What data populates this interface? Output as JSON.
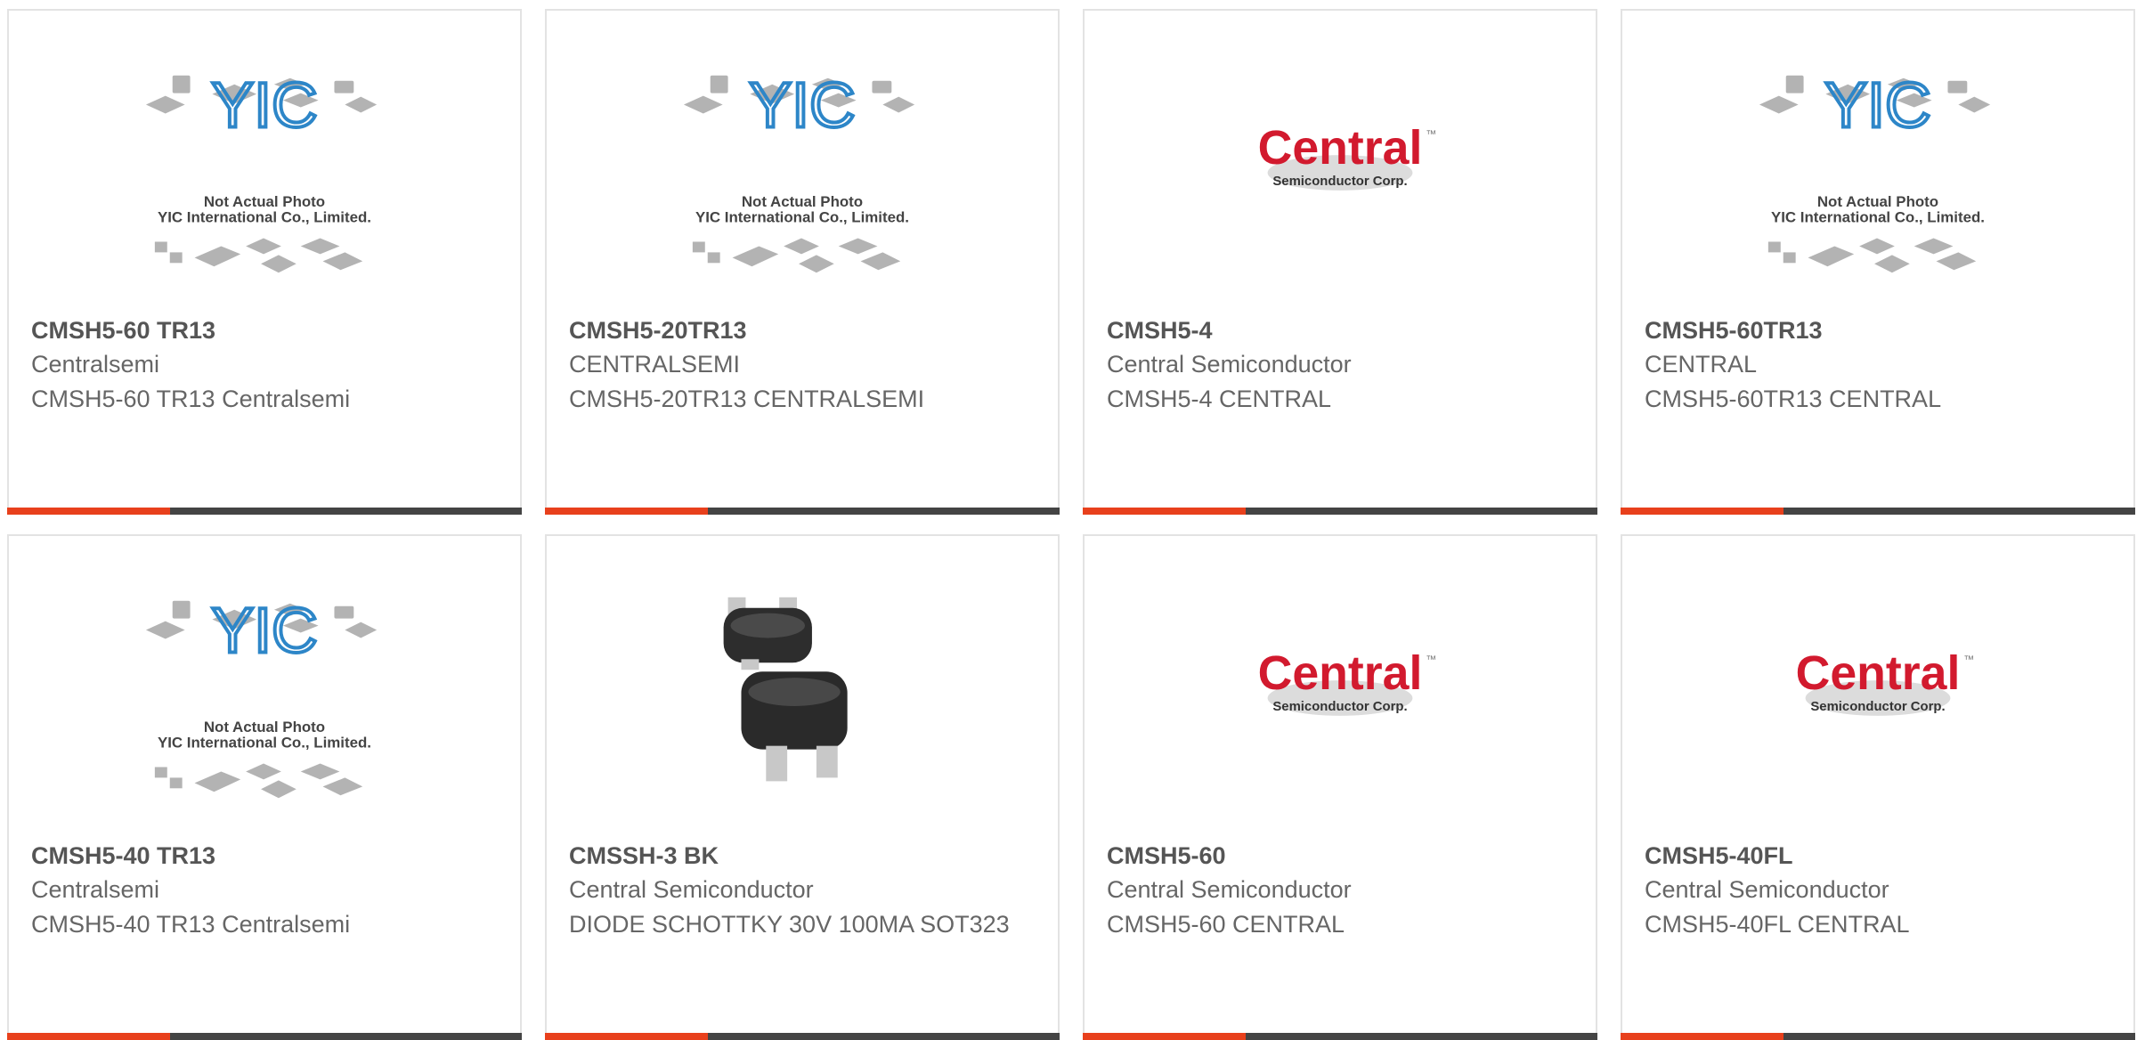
{
  "colors": {
    "accent": "#e8401c",
    "bar": "#444444",
    "title": "#555555",
    "text": "#666666",
    "border": "#e3e3e3",
    "central_red": "#d21a2e",
    "yic_blue": "#2d86c8"
  },
  "placeholder": {
    "brand": "YIC",
    "line1": "Not Actual Photo",
    "line2": "YIC International Co., Limited."
  },
  "central_logo": {
    "word": "Central",
    "tagline": "Semiconductor Corp.",
    "tm": "™"
  },
  "cards": [
    {
      "image": "yic-placeholder",
      "title": "CMSH5-60 TR13",
      "manufacturer": "Centralsemi",
      "description": "CMSH5-60 TR13 Centralsemi"
    },
    {
      "image": "yic-placeholder",
      "title": "CMSH5-20TR13",
      "manufacturer": "CENTRALSEMI",
      "description": "CMSH5-20TR13 CENTRALSEMI"
    },
    {
      "image": "central-logo",
      "title": "CMSH5-4",
      "manufacturer": "Central Semiconductor",
      "description": "CMSH5-4 CENTRAL"
    },
    {
      "image": "yic-placeholder",
      "title": "CMSH5-60TR13",
      "manufacturer": "CENTRAL",
      "description": "CMSH5-60TR13 CENTRAL"
    },
    {
      "image": "yic-placeholder",
      "title": "CMSH5-40 TR13",
      "manufacturer": "Centralsemi",
      "description": "CMSH5-40 TR13 Centralsemi"
    },
    {
      "image": "sot323-photo",
      "title": "CMSSH-3 BK",
      "manufacturer": "Central Semiconductor",
      "description": "DIODE SCHOTTKY 30V 100MA SOT323"
    },
    {
      "image": "central-logo",
      "title": "CMSH5-60",
      "manufacturer": "Central Semiconductor",
      "description": "CMSH5-60 CENTRAL"
    },
    {
      "image": "central-logo",
      "title": "CMSH5-40FL",
      "manufacturer": "Central Semiconductor",
      "description": "CMSH5-40FL CENTRAL"
    }
  ]
}
